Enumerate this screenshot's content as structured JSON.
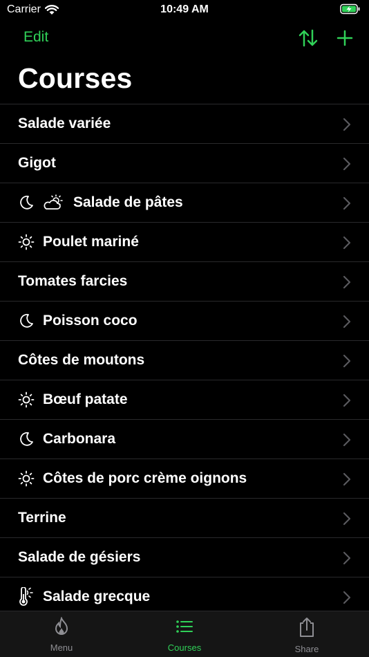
{
  "status": {
    "carrier": "Carrier",
    "time": "10:49 AM"
  },
  "nav": {
    "edit_label": "Edit"
  },
  "title": "Courses",
  "courses": [
    {
      "label": "Salade variée",
      "icons": []
    },
    {
      "label": "Gigot",
      "icons": []
    },
    {
      "label": "Salade de pâtes",
      "icons": [
        "moon-icon",
        "partly-sunny-icon"
      ]
    },
    {
      "label": "Poulet mariné",
      "icons": [
        "sun-icon"
      ]
    },
    {
      "label": "Tomates farcies",
      "icons": []
    },
    {
      "label": "Poisson coco",
      "icons": [
        "moon-icon"
      ]
    },
    {
      "label": "Côtes de moutons",
      "icons": []
    },
    {
      "label": "Bœuf patate",
      "icons": [
        "sun-icon"
      ]
    },
    {
      "label": "Carbonara",
      "icons": [
        "moon-icon"
      ]
    },
    {
      "label": "Côtes de porc crème oignons",
      "icons": [
        "sun-icon"
      ]
    },
    {
      "label": "Terrine",
      "icons": []
    },
    {
      "label": "Salade de gésiers",
      "icons": []
    },
    {
      "label": "Salade grecque",
      "icons": [
        "thermometer-sun-icon"
      ]
    }
  ],
  "tabs": [
    {
      "label": "Menu",
      "icon": "flame-icon"
    },
    {
      "label": "Courses",
      "icon": "list-icon"
    },
    {
      "label": "Share",
      "icon": "share-icon"
    }
  ],
  "colors": {
    "accent": "#30d158",
    "inactive": "#8e8e93",
    "chevron": "#5a5a5e"
  }
}
